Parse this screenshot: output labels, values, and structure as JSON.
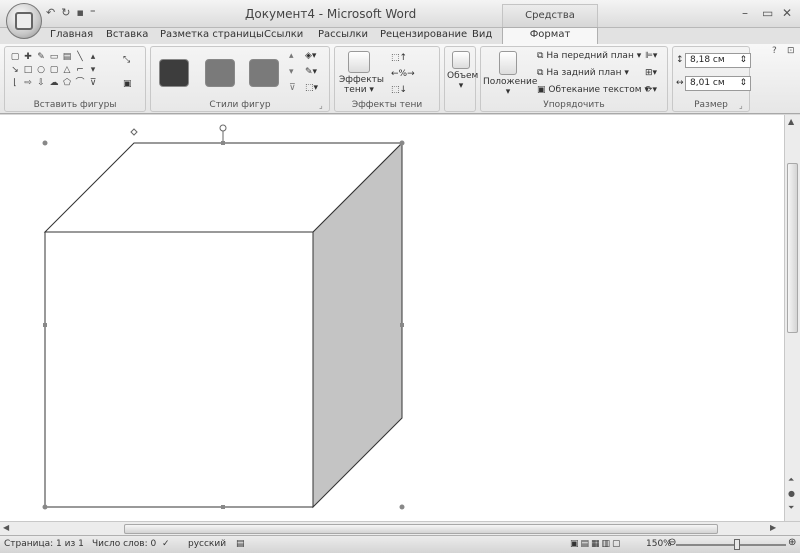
{
  "window": {
    "title": "Документ4 - Microsoft Word",
    "contextual_tab_group": "Средства рисования"
  },
  "tabs": [
    {
      "label": "Главная"
    },
    {
      "label": "Вставка"
    },
    {
      "label": "Разметка страницы"
    },
    {
      "label": "Ссылки"
    },
    {
      "label": "Рассылки"
    },
    {
      "label": "Рецензирование"
    },
    {
      "label": "Вид"
    },
    {
      "label": "Формат",
      "active": true
    }
  ],
  "ribbon": {
    "insert_shapes": {
      "label": "Вставить фигуры"
    },
    "shape_styles": {
      "label": "Стили фигур",
      "swatches": [
        "#3d3d3d",
        "#7a7a7a",
        "#7a7a7a"
      ]
    },
    "shadow_effects": {
      "label": "Эффекты тени",
      "button_line1": "Эффекты",
      "button_line2": "тени"
    },
    "volume": {
      "label": "Объем"
    },
    "arrange": {
      "label": "Упорядочить",
      "position": "Положение",
      "bring_front": "На передний план",
      "send_back": "На задний план",
      "text_wrap": "Обтекание текстом"
    },
    "size": {
      "label": "Размер",
      "height": "8,18 см",
      "width": "8,01 см"
    }
  },
  "status": {
    "page": "Страница: 1 из 1",
    "words": "Число слов: 0",
    "language": "русский",
    "zoom": "150%"
  },
  "colors": {
    "cube_side": "#c4c4c4",
    "handle": "#888888"
  }
}
